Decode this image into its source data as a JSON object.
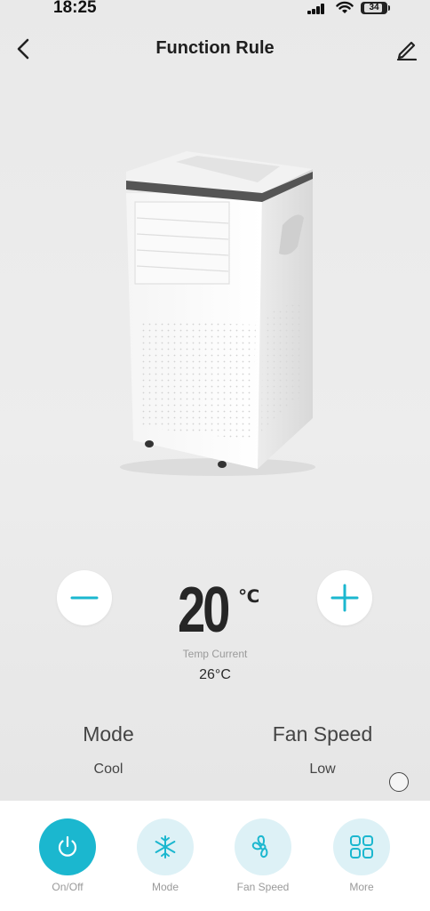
{
  "status_bar": {
    "time": "18:25",
    "battery": "34"
  },
  "header": {
    "title": "Function Rule"
  },
  "temperature": {
    "setpoint": "20",
    "unit": "℃",
    "current_label": "Temp Current",
    "current_value": "26°C"
  },
  "mode": {
    "label": "Mode",
    "value": "Cool"
  },
  "fan_speed": {
    "label": "Fan Speed",
    "value": "Low"
  },
  "tabs": [
    {
      "label": "On/Off",
      "icon": "power-icon",
      "active": true
    },
    {
      "label": "Mode",
      "icon": "snowflake-icon",
      "active": false
    },
    {
      "label": "Fan Speed",
      "icon": "fan-icon",
      "active": false
    },
    {
      "label": "More",
      "icon": "grid-icon",
      "active": false
    }
  ],
  "colors": {
    "accent": "#1bb7cf",
    "accent_light": "#ddf1f6",
    "background": "#ececec"
  }
}
